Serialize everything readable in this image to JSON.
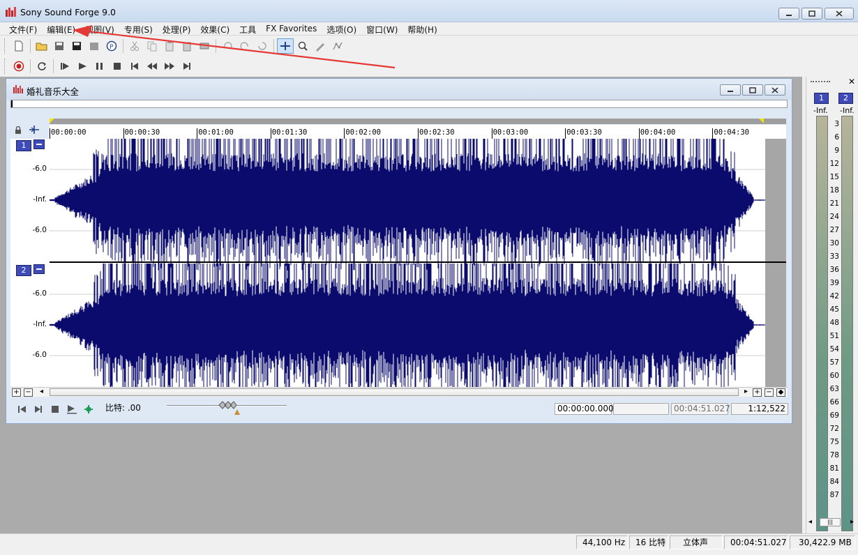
{
  "app": {
    "title": "Sony Sound Forge 9.0"
  },
  "menu": [
    {
      "label": "文件(F)"
    },
    {
      "label": "编辑(E)"
    },
    {
      "label": "视图(V)"
    },
    {
      "label": "专用(S)"
    },
    {
      "label": "处理(P)"
    },
    {
      "label": "效果(C)"
    },
    {
      "label": "工具"
    },
    {
      "label": "FX Favorites"
    },
    {
      "label": "选项(O)"
    },
    {
      "label": "窗口(W)"
    },
    {
      "label": "帮助(H)"
    }
  ],
  "data_window": {
    "title": "婚礼音乐大全",
    "ruler_ticks": [
      "00:00:00",
      "00:00:30",
      "00:01:00",
      "00:01:30",
      "00:02:00",
      "00:02:30",
      "00:03:00",
      "00:03:30",
      "00:04:00",
      "00:04:30"
    ],
    "channels": [
      {
        "number": "1",
        "db_labels": [
          "-6.0",
          "-Inf.",
          "-6.0"
        ]
      },
      {
        "number": "2",
        "db_labels": [
          "-6.0",
          "-Inf.",
          "-6.0"
        ]
      }
    ],
    "transport": {
      "rate_label": "比特: .00",
      "selection_start": "00:00:00.000",
      "selection_length": "",
      "total_length": "00:04:51.027",
      "zoom_ratio": "1:12,522"
    },
    "waveform_color": "#0b0b6e"
  },
  "meters": {
    "channels": [
      "1",
      "2"
    ],
    "peak_labels": [
      "-Inf.",
      "-Inf."
    ],
    "scale": [
      "3",
      "6",
      "9",
      "12",
      "15",
      "18",
      "21",
      "24",
      "27",
      "30",
      "33",
      "36",
      "39",
      "42",
      "45",
      "48",
      "51",
      "54",
      "57",
      "60",
      "63",
      "66",
      "69",
      "72",
      "75",
      "78",
      "81",
      "84",
      "87"
    ]
  },
  "status": {
    "sample_rate": "44,100 Hz",
    "bit_depth": "16 比特",
    "channels": "立体声",
    "length": "00:04:51.027",
    "free_space": "30,422.9 MB"
  },
  "colors": {
    "accent_channel": "#3f4cb8",
    "annotation_arrow": "#e53935"
  }
}
